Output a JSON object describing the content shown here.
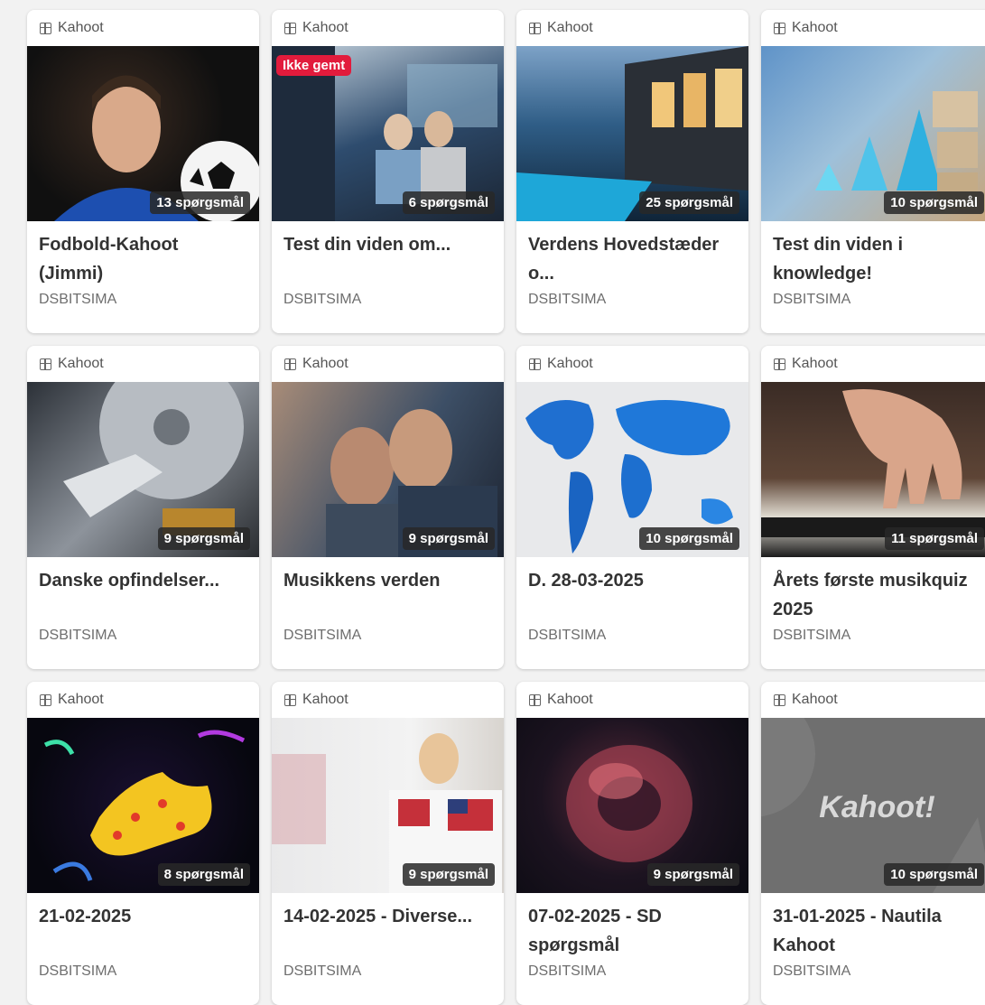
{
  "cards": [
    {
      "type": "Kahoot",
      "title": "Fodbold-Kahoot (Jimmi)",
      "questions": "13 spørgsmål",
      "author": "DSBITSIMA"
    },
    {
      "type": "Kahoot",
      "title": "Test din viden om...",
      "questions": "6 spørgsmål",
      "author": "DSBITSIMA",
      "badge": "Ikke gemt"
    },
    {
      "type": "Kahoot",
      "title": "Verdens Hovedstæder o...",
      "questions": "25 spørgsmål",
      "author": "DSBITSIMA"
    },
    {
      "type": "Kahoot",
      "title": "Test din viden i knowledge!",
      "questions": "10 spørgsmål",
      "author": "DSBITSIMA"
    },
    {
      "type": "Kahoot",
      "title": "Danske opfindelser...",
      "questions": "9 spørgsmål",
      "author": "DSBITSIMA"
    },
    {
      "type": "Kahoot",
      "title": "Musikkens verden",
      "questions": "9 spørgsmål",
      "author": "DSBITSIMA"
    },
    {
      "type": "Kahoot",
      "title": "D. 28-03-2025",
      "questions": "10 spørgsmål",
      "author": "DSBITSIMA"
    },
    {
      "type": "Kahoot",
      "title": "Årets første musikquiz 2025",
      "questions": "11 spørgsmål",
      "author": "DSBITSIMA"
    },
    {
      "type": "Kahoot",
      "title": "21-02-2025",
      "questions": "8 spørgsmål",
      "author": "DSBITSIMA"
    },
    {
      "type": "Kahoot",
      "title": "14-02-2025 - Diverse...",
      "questions": "9 spørgsmål",
      "author": "DSBITSIMA"
    },
    {
      "type": "Kahoot",
      "title": "07-02-2025 - SD spørgsmål",
      "questions": "9 spørgsmål",
      "author": "DSBITSIMA"
    },
    {
      "type": "Kahoot",
      "title": "31-01-2025 - Nautila Kahoot",
      "questions": "10 spørgsmål",
      "author": "DSBITSIMA",
      "thumb_text": "Kahoot!"
    }
  ],
  "icons": {
    "type_icon": "grid-icon"
  }
}
